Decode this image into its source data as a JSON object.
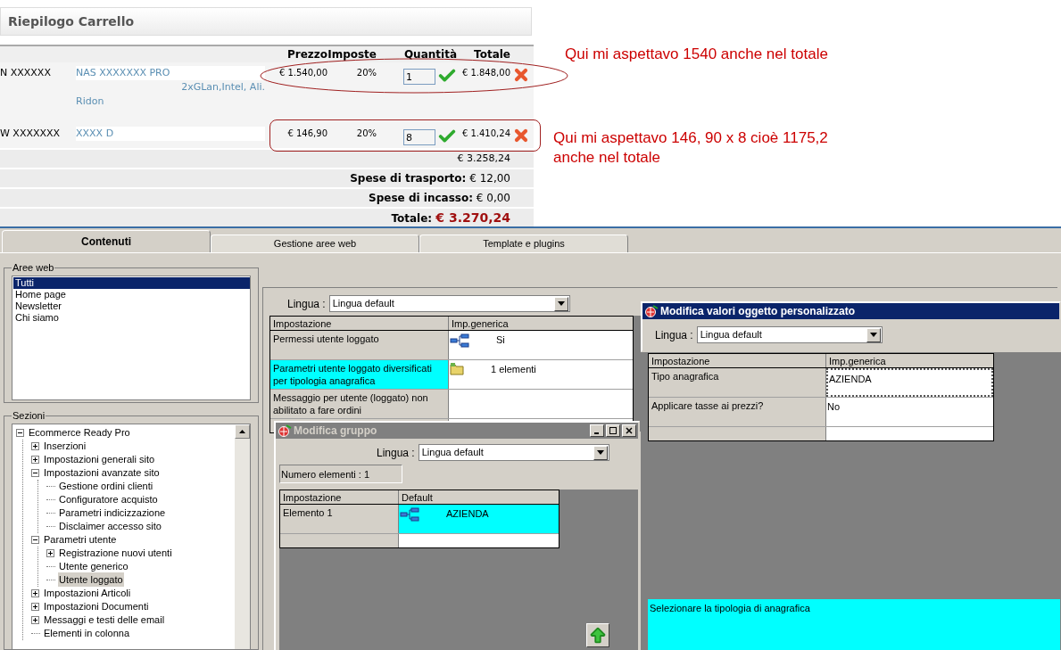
{
  "cart": {
    "title": "Riepilogo Carrello",
    "columns": [
      "Prezzo",
      "Imposte",
      "Quantità",
      "Totale"
    ],
    "items": [
      {
        "code": "N XXXXXX",
        "name": "NAS XXXXXXX PRO",
        "details": [
          "2xGLan,Intel, Ali.",
          "Ridon"
        ],
        "price": "€ 1.540,00",
        "tax": "20%",
        "quantity": "1",
        "total": "€ 1.848,00"
      },
      {
        "code": "W XXXXXXX",
        "name": "XXXX D",
        "price": "€ 146,90",
        "tax": "20%",
        "quantity": "8",
        "total": "€ 1.410,24"
      }
    ],
    "subtotal": "€ 3.258,24",
    "charges": [
      {
        "label": "Spese di trasporto:",
        "value": "€ 12,00"
      },
      {
        "label": "Spese di incasso:",
        "value": "€ 0,00"
      }
    ],
    "total": {
      "label": "Totale:",
      "value": "€ 3.270,24"
    }
  },
  "annotations": [
    "Qui mi aspettavo 1540 anche nel totale",
    "Qui mi aspettavo 146, 90 x 8 cioè 1175,2 anche nel totale"
  ],
  "app": {
    "tabs": [
      {
        "label": "Contenuti",
        "selected": true
      },
      {
        "label": "Gestione aree web",
        "selected": false
      },
      {
        "label": "Template e plugins",
        "selected": false
      }
    ],
    "aree_web": {
      "label": "Aree web",
      "items": [
        {
          "label": "Tutti",
          "selected": true
        },
        {
          "label": "Home page",
          "selected": false
        },
        {
          "label": "Newsletter",
          "selected": false
        },
        {
          "label": "Chi siamo",
          "selected": false
        }
      ]
    },
    "sezioni": {
      "label": "Sezioni",
      "tree": [
        {
          "label": "Ecommerce Ready Pro",
          "kind": "folder",
          "expanded": true,
          "selected": false,
          "children": [
            {
              "label": "Inserzioni",
              "kind": "folder",
              "expanded": false,
              "selected": false
            },
            {
              "label": "Impostazioni generali sito",
              "kind": "folder",
              "expanded": false,
              "selected": false
            },
            {
              "label": "Impostazioni avanzate sito",
              "kind": "folder",
              "expanded": true,
              "selected": false,
              "children": [
                {
                  "label": "Gestione ordini clienti",
                  "kind": "leaf",
                  "selected": false
                },
                {
                  "label": "Configuratore acquisto",
                  "kind": "leaf",
                  "selected": false
                },
                {
                  "label": "Parametri indicizzazione",
                  "kind": "leaf",
                  "selected": false
                },
                {
                  "label": "Disclaimer accesso sito",
                  "kind": "leaf",
                  "selected": false
                }
              ]
            },
            {
              "label": "Parametri utente",
              "kind": "folder",
              "expanded": true,
              "selected": false,
              "children": [
                {
                  "label": "Registrazione nuovi utenti",
                  "kind": "folder",
                  "expanded": false,
                  "selected": false
                },
                {
                  "label": "Utente generico",
                  "kind": "leaf",
                  "selected": false
                },
                {
                  "label": "Utente loggato",
                  "kind": "leaf",
                  "selected": true
                }
              ]
            },
            {
              "label": "Impostazioni Articoli",
              "kind": "folder",
              "expanded": false,
              "selected": false
            },
            {
              "label": "Impostazioni Documenti",
              "kind": "folder",
              "expanded": false,
              "selected": false
            },
            {
              "label": "Messaggi e testi delle email",
              "kind": "folder",
              "expanded": false,
              "selected": false
            },
            {
              "label": "Elementi in colonna",
              "kind": "leaf",
              "selected": false
            }
          ]
        }
      ]
    },
    "settings": {
      "language_label": "Lingua :",
      "language": "Lingua default",
      "columns": [
        "Impostazione",
        "Imp.generica"
      ],
      "rows": [
        {
          "label": "Permessi utente loggato",
          "value": "Si",
          "kind": "choice",
          "selected": false
        },
        {
          "label": "Parametri utente loggato diversificati per tipologia anagrafica",
          "value": "1 elementi",
          "kind": "collection",
          "selected": true
        },
        {
          "label": "Messaggio per utente (loggato) non abilitato a fare ordini",
          "kind": "text",
          "selected": false
        }
      ]
    },
    "group_dialog": {
      "title": "Modifica gruppo",
      "language_label": "Lingua :",
      "language": "Lingua default",
      "count": "Numero elementi : 1",
      "columns": [
        "Impostazione",
        "Default"
      ],
      "rows": [
        {
          "label": "Elemento 1",
          "value": "AZIENDA",
          "kind": "choice",
          "selected": true
        }
      ]
    },
    "values_dialog": {
      "title": "Modifica valori oggetto personalizzato",
      "language_label": "Lingua :",
      "language": "Lingua default",
      "columns": [
        "Impostazione",
        "Imp.generica"
      ],
      "rows": [
        {
          "label": "Tipo anagrafica",
          "value": "AZIENDA",
          "selected": true
        },
        {
          "label": "Applicare tasse ai prezzi?",
          "value": "No",
          "selected": false
        }
      ],
      "description": "Selezionare la tipologia di anagrafica"
    }
  }
}
